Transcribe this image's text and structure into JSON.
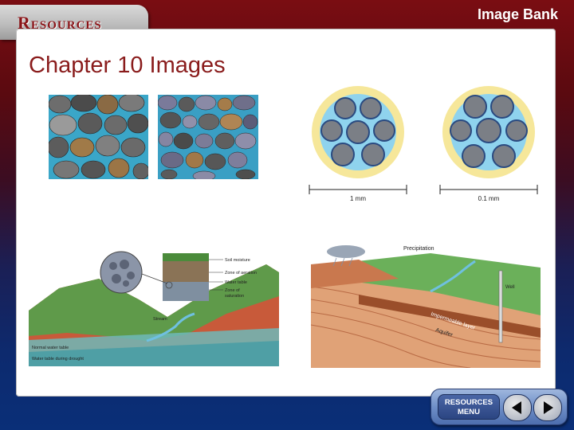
{
  "header": {
    "resources_label": "Resources",
    "image_bank_label": "Image Bank"
  },
  "main": {
    "chapter_title": "Chapter 10 Images",
    "pore_diagram": {
      "scale_left": "1 mm",
      "scale_right": "0.1 mm"
    },
    "water_table_diagram": {
      "labels": {
        "soil_moisture": "Soil moisture",
        "zone_aeration": "Zone of aeration",
        "water_table": "Water table",
        "zone_saturation_1": "Zone of",
        "zone_saturation_2": "saturation",
        "stream": "Stream",
        "normal_water_table": "Normal water table",
        "drought_water_table": "Water table during drought"
      }
    },
    "aquifer_diagram": {
      "labels": {
        "precipitation": "Precipitation",
        "impermeable_layer": "Impermeable layer",
        "aquifer": "Aquifer",
        "well": "Well"
      }
    }
  },
  "footer": {
    "menu_line1": "RESOURCES",
    "menu_line2": "MENU"
  },
  "icons": {
    "prev": "triangle-left-icon",
    "next": "triangle-right-icon"
  },
  "colors": {
    "title_red": "#8a1c1c",
    "tab_text_red": "#8a1418",
    "nav_blue": "#6f8fc8"
  }
}
